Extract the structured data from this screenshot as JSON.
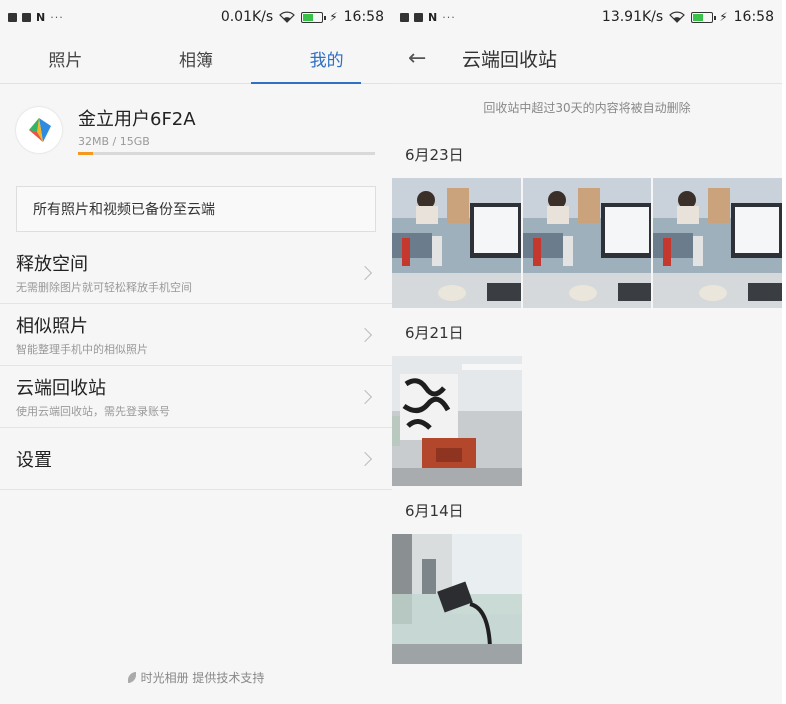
{
  "left": {
    "status": {
      "speed": "0.01K/s",
      "time": "16:58",
      "dots": "···"
    },
    "tabs": [
      {
        "label": "照片"
      },
      {
        "label": "相簿"
      },
      {
        "label": "我的"
      }
    ],
    "active_tab": 2,
    "profile": {
      "name": "金立用户6F2A",
      "quota": "32MB / 15GB",
      "used_fraction": 0.002
    },
    "backup_notice": "所有照片和视频已备份至云端",
    "menu": [
      {
        "title": "释放空间",
        "subtitle": "无需删除图片就可轻松释放手机空间"
      },
      {
        "title": "相似照片",
        "subtitle": "智能整理手机中的相似照片"
      },
      {
        "title": "云端回收站",
        "subtitle": "使用云端回收站，需先登录账号"
      },
      {
        "title": "设置",
        "subtitle": ""
      }
    ],
    "footer": "时光相册 提供技术支持"
  },
  "right": {
    "status": {
      "speed": "13.91K/s",
      "time": "16:58",
      "dots": "···"
    },
    "title": "云端回收站",
    "notice": "回收站中超过30天的内容将被自动删除",
    "sections": [
      {
        "date": "6月23日",
        "photos": 3
      },
      {
        "date": "6月21日",
        "photos": 1
      },
      {
        "date": "6月14日",
        "photos": 1
      }
    ]
  },
  "colors": {
    "accent": "#2f6fc4",
    "quota_fill": "#f39a1e",
    "battery": "#39c24a"
  }
}
